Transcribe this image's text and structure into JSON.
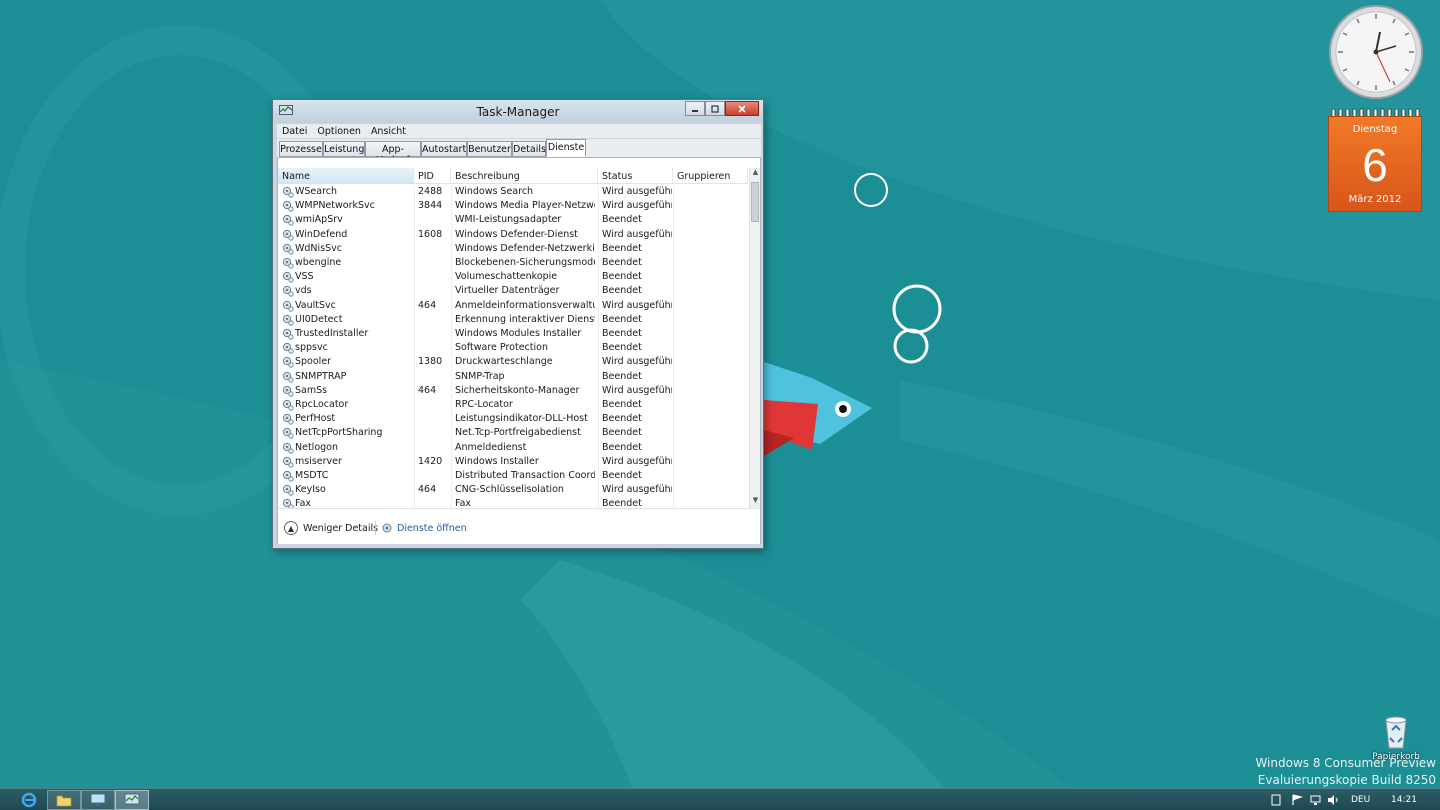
{
  "window": {
    "title": "Task-Manager",
    "minimize_icon": "minimize-icon",
    "maximize_icon": "maximize-icon",
    "close_icon": "close-icon"
  },
  "menu": [
    "Datei",
    "Optionen",
    "Ansicht"
  ],
  "tabs": [
    {
      "label": "Prozesse",
      "active": false
    },
    {
      "label": "Leistung",
      "active": false
    },
    {
      "label": "App-Verlauf",
      "active": false
    },
    {
      "label": "Autostart",
      "active": false
    },
    {
      "label": "Benutzer",
      "active": false
    },
    {
      "label": "Details",
      "active": false
    },
    {
      "label": "Dienste",
      "active": true
    }
  ],
  "columns": [
    "Name",
    "PID",
    "Beschreibung",
    "Status",
    "Gruppieren"
  ],
  "services": [
    {
      "name": "WSearch",
      "pid": "2488",
      "desc": "Windows Search",
      "status": "Wird ausgeführt"
    },
    {
      "name": "WMPNetworkSvc",
      "pid": "3844",
      "desc": "Windows Media Player-Netzwer...",
      "status": "Wird ausgeführt"
    },
    {
      "name": "wmiApSrv",
      "pid": "",
      "desc": "WMI-Leistungsadapter",
      "status": "Beendet"
    },
    {
      "name": "WinDefend",
      "pid": "1608",
      "desc": "Windows Defender-Dienst",
      "status": "Wird ausgeführt"
    },
    {
      "name": "WdNisSvc",
      "pid": "",
      "desc": "Windows Defender-Netzwerkins...",
      "status": "Beendet"
    },
    {
      "name": "wbengine",
      "pid": "",
      "desc": "Blockebenen-Sicherungsmodul",
      "status": "Beendet"
    },
    {
      "name": "VSS",
      "pid": "",
      "desc": "Volumeschattenkopie",
      "status": "Beendet"
    },
    {
      "name": "vds",
      "pid": "",
      "desc": "Virtueller Datenträger",
      "status": "Beendet"
    },
    {
      "name": "VaultSvc",
      "pid": "464",
      "desc": "Anmeldeinformationsverwaltung",
      "status": "Wird ausgeführt"
    },
    {
      "name": "UI0Detect",
      "pid": "",
      "desc": "Erkennung interaktiver Dienste",
      "status": "Beendet"
    },
    {
      "name": "TrustedInstaller",
      "pid": "",
      "desc": "Windows Modules Installer",
      "status": "Beendet"
    },
    {
      "name": "sppsvc",
      "pid": "",
      "desc": "Software Protection",
      "status": "Beendet"
    },
    {
      "name": "Spooler",
      "pid": "1380",
      "desc": "Druckwarteschlange",
      "status": "Wird ausgeführt"
    },
    {
      "name": "SNMPTRAP",
      "pid": "",
      "desc": "SNMP-Trap",
      "status": "Beendet"
    },
    {
      "name": "SamSs",
      "pid": "464",
      "desc": "Sicherheitskonto-Manager",
      "status": "Wird ausgeführt"
    },
    {
      "name": "RpcLocator",
      "pid": "",
      "desc": "RPC-Locator",
      "status": "Beendet"
    },
    {
      "name": "PerfHost",
      "pid": "",
      "desc": "Leistungsindikator-DLL-Host",
      "status": "Beendet"
    },
    {
      "name": "NetTcpPortSharing",
      "pid": "",
      "desc": "Net.Tcp-Portfreigabedienst",
      "status": "Beendet"
    },
    {
      "name": "Netlogon",
      "pid": "",
      "desc": "Anmeldedienst",
      "status": "Beendet"
    },
    {
      "name": "msiserver",
      "pid": "1420",
      "desc": "Windows Installer",
      "status": "Wird ausgeführt"
    },
    {
      "name": "MSDTC",
      "pid": "",
      "desc": "Distributed Transaction Coordin...",
      "status": "Beendet"
    },
    {
      "name": "KeyIso",
      "pid": "464",
      "desc": "CNG-Schlüsselisolation",
      "status": "Wird ausgeführt"
    },
    {
      "name": "Fax",
      "pid": "",
      "desc": "Fax",
      "status": "Beendet"
    }
  ],
  "footer": {
    "fewer_details": "Weniger Details",
    "open_services": "Dienste öffnen"
  },
  "calendar": {
    "weekday": "Dienstag",
    "day": "6",
    "month_year": "März 2012"
  },
  "desktop": {
    "recycle_bin": "Papierkorb",
    "watermark_line1": "Windows 8 Consumer Preview",
    "watermark_line2": "Evaluierungskopie Build 8250"
  },
  "taskbar": {
    "language": "DEU",
    "time": "14:21",
    "icons": [
      "internet-explorer-icon",
      "explorer-folder-icon",
      "remote-desktop-icon",
      "task-manager-icon"
    ]
  },
  "colors": {
    "desktop_bg": "#1c8e95",
    "calendar": "#e8661f",
    "link": "#1e5ea8"
  }
}
